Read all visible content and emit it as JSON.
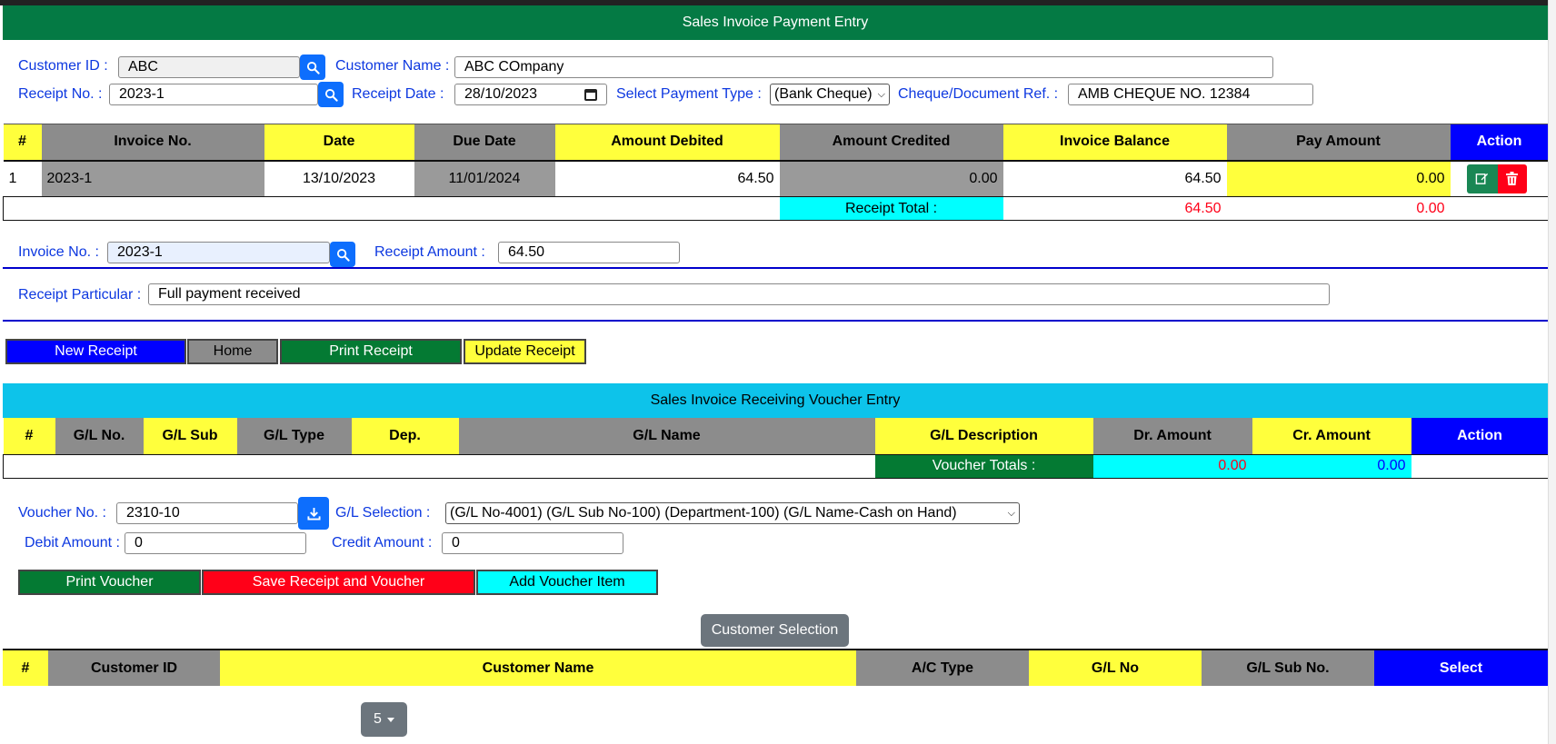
{
  "payment": {
    "title": "Sales Invoice Payment Entry",
    "customer_id_label": "Customer ID :",
    "customer_id": "ABC",
    "customer_name_label": "Customer Name :",
    "customer_name": "ABC COmpany",
    "receipt_no_label": "Receipt No. :",
    "receipt_no": "2023-1",
    "receipt_date_label": "Receipt Date :",
    "receipt_date": "28/10/2023",
    "payment_type_label": "Select Payment Type :",
    "payment_type": "(Bank Cheque)",
    "cheque_ref_label": "Cheque/Document Ref. :",
    "cheque_ref": "AMB CHEQUE NO. 12384"
  },
  "invoice_table": {
    "headers": [
      "#",
      "Invoice No.",
      "Date",
      "Due Date",
      "Amount Debited",
      "Amount Credited",
      "Invoice Balance",
      "Pay Amount",
      "Action"
    ],
    "rows": [
      {
        "num": "1",
        "invoice_no": "2023-1",
        "date": "13/10/2023",
        "due_date": "11/01/2024",
        "debited": "64.50",
        "credited": "0.00",
        "balance": "64.50",
        "pay": "0.00"
      }
    ],
    "total_label": "Receipt Total :",
    "total_balance": "64.50",
    "total_pay": "0.00"
  },
  "invoice_entry": {
    "invoice_no_label": "Invoice No. :",
    "invoice_no": "2023-1",
    "receipt_amount_label": "Receipt Amount :",
    "receipt_amount": "64.50",
    "particular_label": "Receipt Particular :",
    "particular": "Full payment received"
  },
  "buttons": {
    "new_receipt": "New Receipt",
    "home": "Home",
    "print_receipt": "Print Receipt",
    "update_receipt": "Update Receipt"
  },
  "voucher": {
    "title": "Sales Invoice Receiving Voucher Entry",
    "headers": [
      "#",
      "G/L No.",
      "G/L Sub",
      "G/L Type",
      "Dep.",
      "G/L Name",
      "G/L Description",
      "Dr. Amount",
      "Cr. Amount",
      "Action"
    ],
    "totals_label": "Voucher Totals :",
    "dr_total": "0.00",
    "cr_total": "0.00",
    "voucher_no_label": "Voucher No. :",
    "voucher_no": "2310-10",
    "gl_selection_label": "G/L Selection :",
    "gl_selection": "(G/L No-4001) (G/L Sub No-100) (Department-100) (G/L Name-Cash on Hand)",
    "debit_label": "Debit Amount :",
    "debit": "0",
    "credit_label": "Credit Amount :",
    "credit": "0",
    "print_voucher": "Print Voucher",
    "save": "Save Receipt and Voucher",
    "add_item": "Add Voucher Item"
  },
  "customer_selection": {
    "button": "Customer Selection",
    "headers": [
      "#",
      "Customer ID",
      "Customer Name",
      "A/C Type",
      "G/L No",
      "G/L Sub No.",
      "Select"
    ],
    "page_size": "5"
  },
  "colors": {
    "green": "#047a44",
    "blue": "#0000ff",
    "yellow": "#ffff3c",
    "grey": "#8c8c8c",
    "cyan": "#00ffff",
    "red": "#ff0018",
    "label_blue": "#0d38e0"
  }
}
